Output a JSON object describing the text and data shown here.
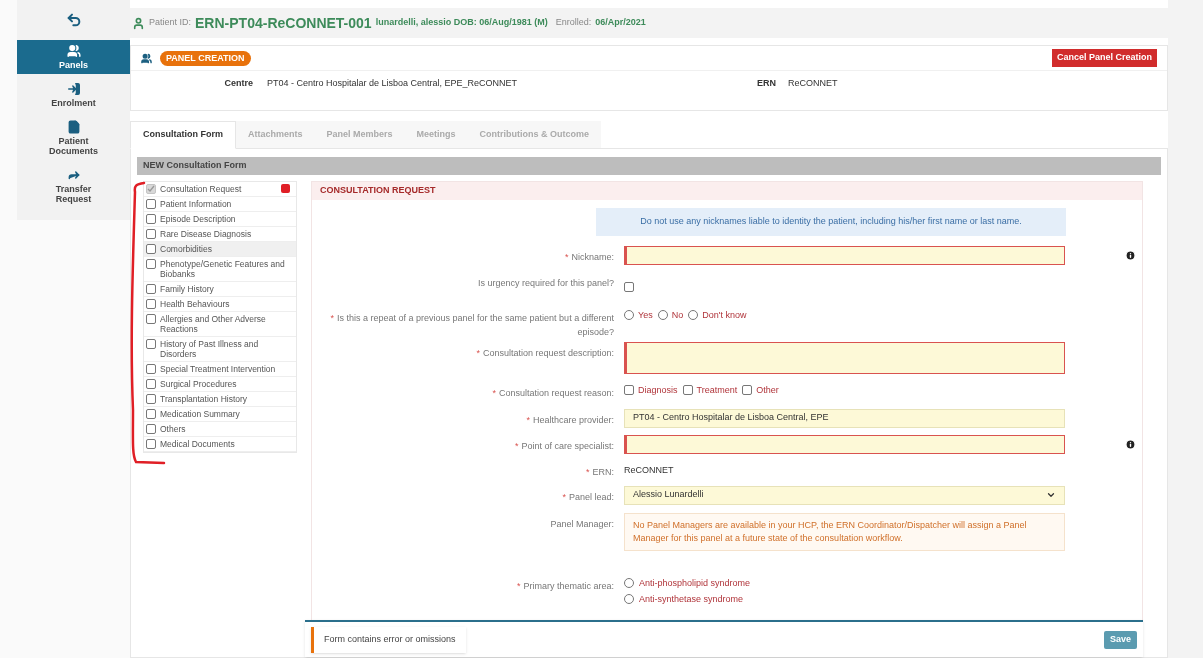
{
  "nav": {
    "items": [
      {
        "label": "Panels",
        "selected": true
      },
      {
        "label": "Enrolment",
        "selected": false
      },
      {
        "label": "Patient Documents",
        "selected": false
      },
      {
        "label": "Transfer Request",
        "selected": false
      }
    ]
  },
  "patient": {
    "id_label": "Patient ID:",
    "id": "ERN-PT04-ReCONNET-001",
    "name_dob": "lunardelli, alessio DOB: 06/Aug/1981 (M)",
    "enrolled_label": "Enrolled:",
    "enrolled": "06/Apr/2021"
  },
  "panel": {
    "badge": "PANEL CREATION",
    "cancel_button": "Cancel Panel Creation",
    "centre_label": "Centre",
    "centre": "PT04 - Centro Hospitalar de Lisboa Central, EPE_ReCONNET",
    "ern_label": "ERN",
    "ern": "ReCONNET"
  },
  "tabs": [
    {
      "label": "Consultation Form",
      "selected": true
    },
    {
      "label": "Attachments",
      "selected": false
    },
    {
      "label": "Panel Members",
      "selected": false
    },
    {
      "label": "Meetings",
      "selected": false
    },
    {
      "label": "Contributions & Outcome",
      "selected": false
    }
  ],
  "form_title": "NEW Consultation Form",
  "sections": [
    {
      "label": "Consultation Request",
      "checked": true,
      "disabled": true,
      "error": true,
      "highlighted": false
    },
    {
      "label": "Patient Information",
      "checked": false,
      "disabled": false,
      "error": false,
      "highlighted": false
    },
    {
      "label": "Episode Description",
      "checked": false,
      "disabled": false,
      "error": false,
      "highlighted": false
    },
    {
      "label": "Rare Disease Diagnosis",
      "checked": false,
      "disabled": false,
      "error": false,
      "highlighted": false
    },
    {
      "label": "Comorbidities",
      "checked": false,
      "disabled": false,
      "error": false,
      "highlighted": true
    },
    {
      "label": "Phenotype/Genetic Features and Biobanks",
      "checked": false,
      "disabled": false,
      "error": false,
      "highlighted": false
    },
    {
      "label": "Family History",
      "checked": false,
      "disabled": false,
      "error": false,
      "highlighted": false
    },
    {
      "label": "Health Behaviours",
      "checked": false,
      "disabled": false,
      "error": false,
      "highlighted": false
    },
    {
      "label": "Allergies and Other Adverse Reactions",
      "checked": false,
      "disabled": false,
      "error": false,
      "highlighted": false
    },
    {
      "label": "History of Past Illness and Disorders",
      "checked": false,
      "disabled": false,
      "error": false,
      "highlighted": false
    },
    {
      "label": "Special Treatment Intervention",
      "checked": false,
      "disabled": false,
      "error": false,
      "highlighted": false
    },
    {
      "label": "Surgical Procedures",
      "checked": false,
      "disabled": false,
      "error": false,
      "highlighted": false
    },
    {
      "label": "Transplantation History",
      "checked": false,
      "disabled": false,
      "error": false,
      "highlighted": false
    },
    {
      "label": "Medication Summary",
      "checked": false,
      "disabled": false,
      "error": false,
      "highlighted": false
    },
    {
      "label": "Others",
      "checked": false,
      "disabled": false,
      "error": false,
      "highlighted": false
    },
    {
      "label": "Medical Documents",
      "checked": false,
      "disabled": false,
      "error": false,
      "highlighted": false
    }
  ],
  "section_title": "CONSULTATION REQUEST",
  "notice": "Do not use any nicknames liable to identity the patient, including his/her first name or last name.",
  "fields": [
    {
      "kind": "text",
      "mark": "*",
      "label": "Nickname:",
      "error": true,
      "info": true
    },
    {
      "kind": "checkbox",
      "label": "Is urgency required for this panel?",
      "checked": false
    },
    {
      "kind": "radio",
      "mark": "*",
      "label": "Is this a repeat of a previous panel for the same patient but a different episode?",
      "options": [
        {
          "label": "Yes",
          "selected": false
        },
        {
          "label": "No",
          "selected": false
        },
        {
          "label": "Don't know",
          "selected": false
        }
      ]
    },
    {
      "kind": "textarea",
      "mark": "*",
      "label": "Consultation request description:",
      "error": true
    },
    {
      "kind": "checks",
      "mark": "*",
      "label": "Consultation request reason:",
      "options": [
        {
          "label": "Diagnosis",
          "checked": false
        },
        {
          "label": "Treatment",
          "checked": false
        },
        {
          "label": "Other",
          "checked": false
        }
      ]
    },
    {
      "kind": "text",
      "mark": "*",
      "label": "Healthcare provider:",
      "value": "PT04 - Centro Hospitalar de Lisboa Central, EPE",
      "error": false,
      "info": false
    },
    {
      "kind": "text",
      "mark": "*",
      "label": "Point of care specialist:",
      "error": true,
      "info": true
    },
    {
      "kind": "static",
      "mark": "*",
      "label": "ERN:",
      "value": "ReCONNET"
    },
    {
      "kind": "select",
      "mark": "*",
      "label": "Panel lead:",
      "value": "Alessio Lunardelli"
    },
    {
      "kind": "warning",
      "label": "Panel Manager:",
      "text": "No Panel Managers are available in your HCP, the ERN Coordinator/Dispatcher will assign a Panel Manager for this panel at a future state of the consultation workflow."
    },
    {
      "kind": "radio-list",
      "mark": "*",
      "label": "Primary thematic area:",
      "options": [
        {
          "label": "Anti-phospholipid syndrome",
          "selected": false
        },
        {
          "label": "Anti-synthetase syndrome",
          "selected": false
        }
      ]
    }
  ],
  "footer": {
    "message": "Form contains error or omissions",
    "save_button": "Save"
  }
}
